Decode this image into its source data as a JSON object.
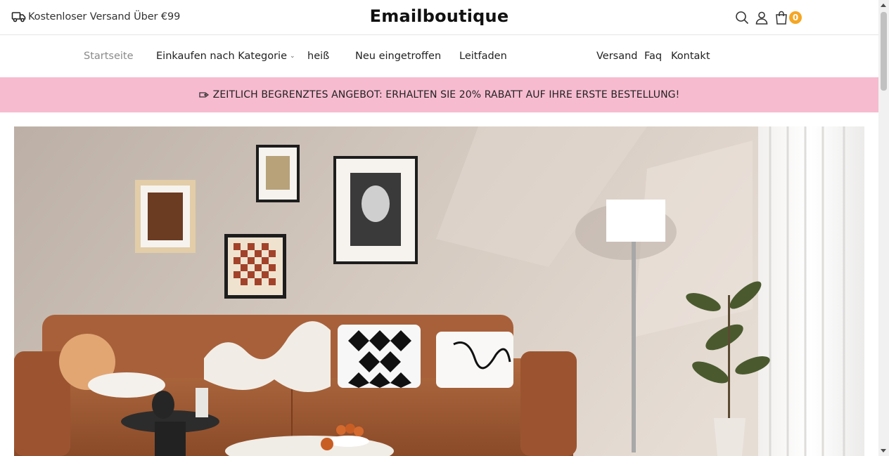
{
  "topbar": {
    "shipping_text": "Kostenloser Versand Über €99",
    "brand": "Emailboutique",
    "cart_count": "0",
    "icons": [
      "truck-icon",
      "search-icon",
      "user-icon",
      "bag-icon"
    ]
  },
  "nav": {
    "left": [
      "Startseite",
      "Einkaufen nach Kategorie",
      "heiß",
      "Neu eingetroffen",
      "Leitfaden"
    ],
    "right": [
      "Versand",
      "Faq",
      "Kontakt"
    ]
  },
  "promo": {
    "text": "ZEITLICH BEGRENZTES ANGEBOT: ERHALTEN SIE 20% RABATT AUF IHRE ERSTE BESTELLUNG!",
    "background": "#f7bbd0"
  },
  "colors": {
    "accent": "#f5a623",
    "muted_nav": "#8a8a8a"
  }
}
